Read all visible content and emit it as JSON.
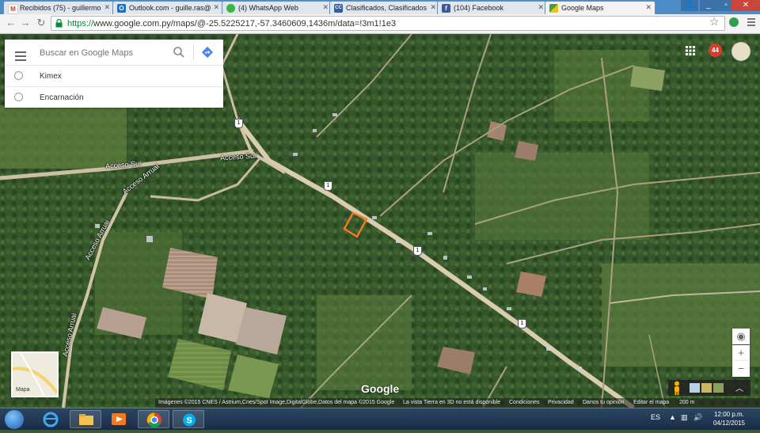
{
  "browser": {
    "tabs": [
      {
        "label": "Recibidos (75) - guillermo",
        "favicon": "gmail-icon",
        "fav_char": "M",
        "fav_color": "#ffffff"
      },
      {
        "label": "Outlook.com - guille.ras@",
        "favicon": "outlook-icon",
        "fav_char": "O",
        "fav_color": "#1f6fc4"
      },
      {
        "label": "(4) WhatsApp Web",
        "favicon": "whatsapp-icon",
        "fav_char": "",
        "fav_color": "#39b54a"
      },
      {
        "label": "Clasificados, Clasificados",
        "favicon": "clasificados-icon",
        "fav_char": "CC",
        "fav_color": "#2f5e9e"
      },
      {
        "label": "(104) Facebook",
        "favicon": "facebook-icon",
        "fav_char": "f",
        "fav_color": "#3b5998"
      },
      {
        "label": "Google Maps",
        "favicon": "google-maps-icon",
        "fav_char": "",
        "fav_color": "#4a9a48",
        "active": true
      }
    ],
    "url_scheme": "https://",
    "url_rest": "www.google.com.py/maps/@-25.5225217,-57.3460609,1436m/data=!3m1!1e3"
  },
  "search": {
    "placeholder": "Buscar en Google Maps",
    "recent": [
      "Kimex",
      "Encarnación"
    ]
  },
  "account": {
    "notifications": "44"
  },
  "map": {
    "road_labels": {
      "acceso_sur_1": "Acceso Sur",
      "acceso_sur_2": "Acceso Sur",
      "acceso_arruai_1": "Acceso Arruai",
      "acceso_arruai_2": "Acceso Arruai",
      "acceso_arruai_3": "Acceso Arruai"
    },
    "route_shields": [
      "1",
      "1",
      "1",
      "1"
    ],
    "minimap_label": "Mapa",
    "logo": "Google",
    "marker_color": "#f07b22"
  },
  "footer": {
    "attribution": "Imágenes ©2015 CNES / Astrium,Cnes/Spot Image,DigitalGlobe,Datos del mapa ©2015 Google",
    "notice": "La vista Tierra en 3D no está disponible",
    "links": [
      "Condiciones",
      "Privacidad",
      "Danos tu opinión",
      "Editar el mapa"
    ],
    "scale": "200 m"
  },
  "taskbar": {
    "language": "ES",
    "time": "12:00 p.m.",
    "date": "04/12/2015"
  }
}
